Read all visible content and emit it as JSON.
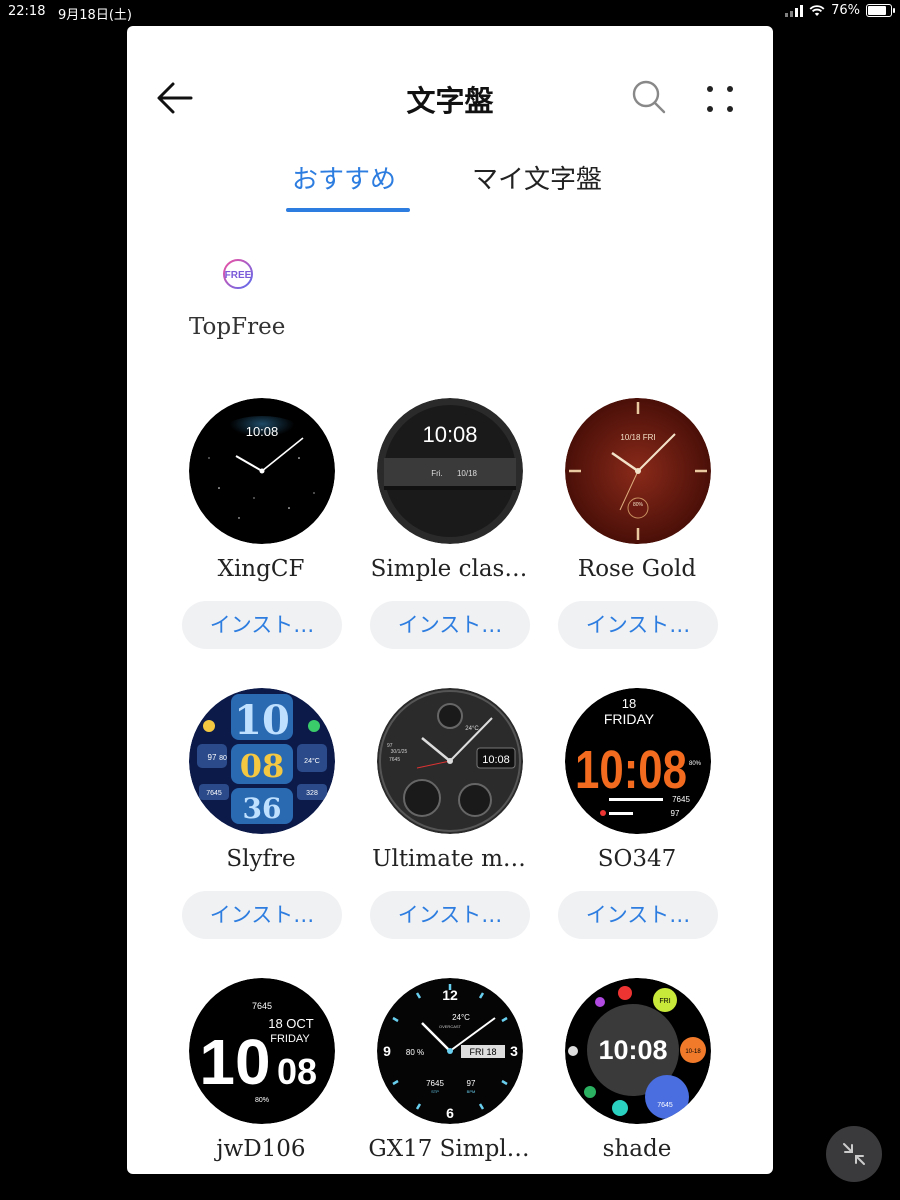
{
  "status_bar": {
    "time": "22:18",
    "date": "9月18日(土)",
    "battery": "76%",
    "battery_level": 0.76
  },
  "header": {
    "title": "文字盤",
    "back_icon": "arrow-left-icon",
    "search_icon": "search-icon",
    "more_icon": "more-dots-icon"
  },
  "tabs": [
    {
      "label": "おすすめ",
      "active": true
    },
    {
      "label": "マイ文字盤",
      "active": false
    }
  ],
  "category": {
    "badge_text": "FREE",
    "label": "TopFree"
  },
  "watch_faces": [
    {
      "name": "XingCF",
      "button": "インスト…",
      "face": {
        "time": "10:08"
      }
    },
    {
      "name": "Simple clas…",
      "button": "インスト…",
      "face": {
        "time": "10:08",
        "day": "Fri.",
        "date": "10/18"
      }
    },
    {
      "name": "Rose Gold",
      "button": "インスト…",
      "face": {
        "date": "10/18",
        "day": "FRI",
        "battery": "80%"
      }
    },
    {
      "name": "Slyfre",
      "button": "インスト…",
      "face": {
        "hour": "10",
        "minute": "08",
        "second": "36",
        "steps": "7645",
        "heart": "97",
        "battery": "80",
        "temp": "24°C",
        "cal": "328"
      }
    },
    {
      "name": "Ultimate m…",
      "button": "インスト…",
      "face": {
        "time": "10:08",
        "temp": "24°C",
        "date": "30/1/25",
        "steps": "7645",
        "heart": "97"
      }
    },
    {
      "name": "SO347",
      "button": "インスト…",
      "face": {
        "date": "18",
        "day": "FRIDAY",
        "time": "10:08",
        "battery": "80%",
        "steps": "7645",
        "heart": "97"
      }
    },
    {
      "name": "jwD106",
      "button": "",
      "face": {
        "steps": "7645",
        "hour": "10",
        "minute": "08",
        "date": "18 OCT",
        "day": "FRIDAY",
        "battery": "80%"
      }
    },
    {
      "name": "GX17 Simpl…",
      "button": "",
      "face": {
        "temp": "24°C",
        "weather": "OVERCAST",
        "battery": "80 %",
        "date": "FRI 18",
        "steps": "7645",
        "steps_label": "STP",
        "heart": "97",
        "heart_label": "BPM",
        "n12": "12",
        "n3": "3",
        "n6": "6",
        "n9": "9"
      }
    },
    {
      "name": "shade",
      "button": "",
      "face": {
        "time": "10:08",
        "day": "FRI",
        "date": "10-18",
        "steps": "7645"
      }
    }
  ],
  "colors": {
    "accent": "#2d7de0",
    "button_bg": "#f0f1f3",
    "so347_orange": "#f26b1f"
  },
  "fab_icon": "collapse-arrows-icon"
}
